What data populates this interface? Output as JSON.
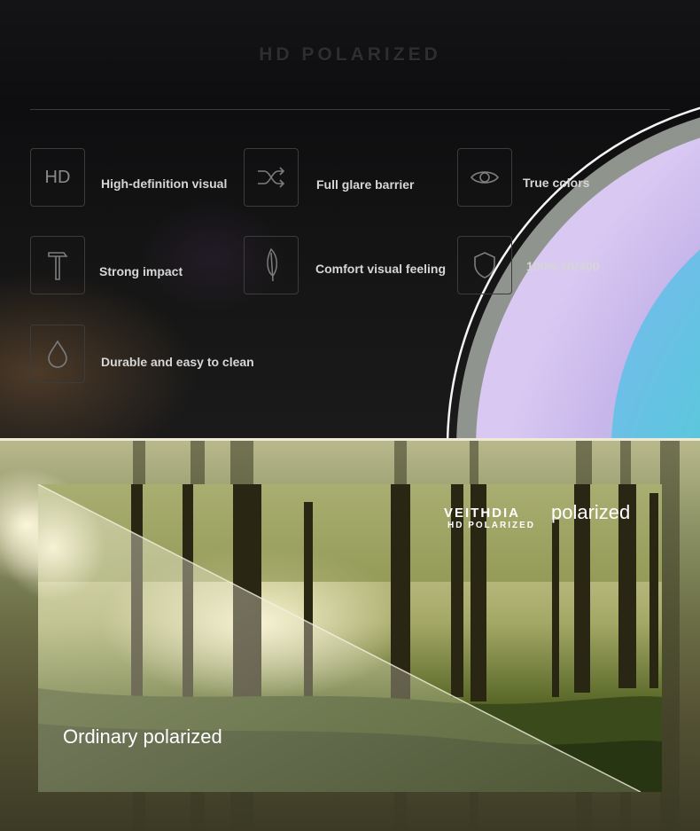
{
  "header": {
    "title": "HD POLARIZED"
  },
  "features": [
    {
      "icon": "hd-icon",
      "icon_text": "HD",
      "label": "High-definition visual"
    },
    {
      "icon": "shuffle-icon",
      "label": "Full glare barrier"
    },
    {
      "icon": "eye-icon",
      "label": "True colors"
    },
    {
      "icon": "hammer-icon",
      "label": "Strong impact"
    },
    {
      "icon": "feather-icon",
      "label": "Comfort visual feeling"
    },
    {
      "icon": "shield-icon",
      "label": "100% UV400"
    },
    {
      "icon": "droplet-icon",
      "label": "Durable and easy to clean"
    }
  ],
  "comparison": {
    "ordinary_label": "Ordinary polarized",
    "brand_name": "VEITHDIA",
    "brand_word": "polarized",
    "brand_sub": "HD POLARIZED"
  }
}
